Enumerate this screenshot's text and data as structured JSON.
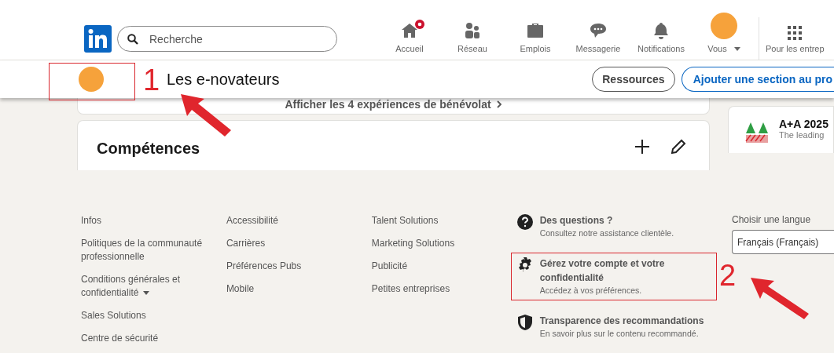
{
  "nav": {
    "search": {
      "placeholder": "Recherche"
    },
    "items": [
      {
        "kind": "home",
        "label": "Accueil",
        "badge": true
      },
      {
        "kind": "network",
        "label": "Réseau",
        "badge": false
      },
      {
        "kind": "jobs",
        "label": "Emplois",
        "badge": false
      },
      {
        "kind": "messages",
        "label": "Messagerie",
        "badge": false
      },
      {
        "kind": "bell",
        "label": "Notifications",
        "badge": false
      },
      {
        "kind": "me",
        "label": "Vous",
        "badge": false
      }
    ],
    "business": {
      "label": "Pour les entrep"
    }
  },
  "profile_bar": {
    "name": "Les e-novateurs",
    "buttons": [
      {
        "kind": "secondary",
        "label": "Ressources"
      },
      {
        "kind": "primary",
        "label": "Ajouter une section au pro"
      }
    ]
  },
  "main": {
    "volunteer_link": "Afficher les 4 expériences de bénévolat",
    "skills": {
      "title": "Compétences"
    },
    "ad": {
      "title": "A+A 2025",
      "subtitle": "The leading"
    }
  },
  "footer": {
    "columns": [
      [
        {
          "label": "Infos",
          "dropdown": false
        },
        {
          "label": "Politiques de la communauté professionnelle",
          "dropdown": false
        },
        {
          "label": "Conditions générales et confidentialité",
          "dropdown": true
        },
        {
          "label": "Sales Solutions",
          "dropdown": false
        },
        {
          "label": "Centre de sécurité",
          "dropdown": false
        }
      ],
      [
        {
          "label": "Accessibilité",
          "dropdown": false
        },
        {
          "label": "Carrières",
          "dropdown": false
        },
        {
          "label": "Préférences Pubs",
          "dropdown": false
        },
        {
          "label": "Mobile",
          "dropdown": false
        }
      ],
      [
        {
          "label": "Talent Solutions",
          "dropdown": false
        },
        {
          "label": "Marketing Solutions",
          "dropdown": false
        },
        {
          "label": "Publicité",
          "dropdown": false
        },
        {
          "label": "Petites entreprises",
          "dropdown": false
        }
      ]
    ],
    "help": [
      {
        "kind": "question",
        "title": "Des questions ?",
        "text": "Consultez notre assistance clientèle.",
        "highlighted": false
      },
      {
        "kind": "gear",
        "title": "Gérez votre compte et votre confidentialité",
        "text": "Accédez à vos préférences.",
        "highlighted": true
      },
      {
        "kind": "shield",
        "title": "Transparence des recommandations",
        "text": "En savoir plus sur le contenu recommandé.",
        "highlighted": false
      }
    ],
    "language": {
      "label": "Choisir une langue",
      "value": "Français (Français)"
    }
  },
  "annotations": [
    {
      "label": "1"
    },
    {
      "label": "2"
    }
  ]
}
